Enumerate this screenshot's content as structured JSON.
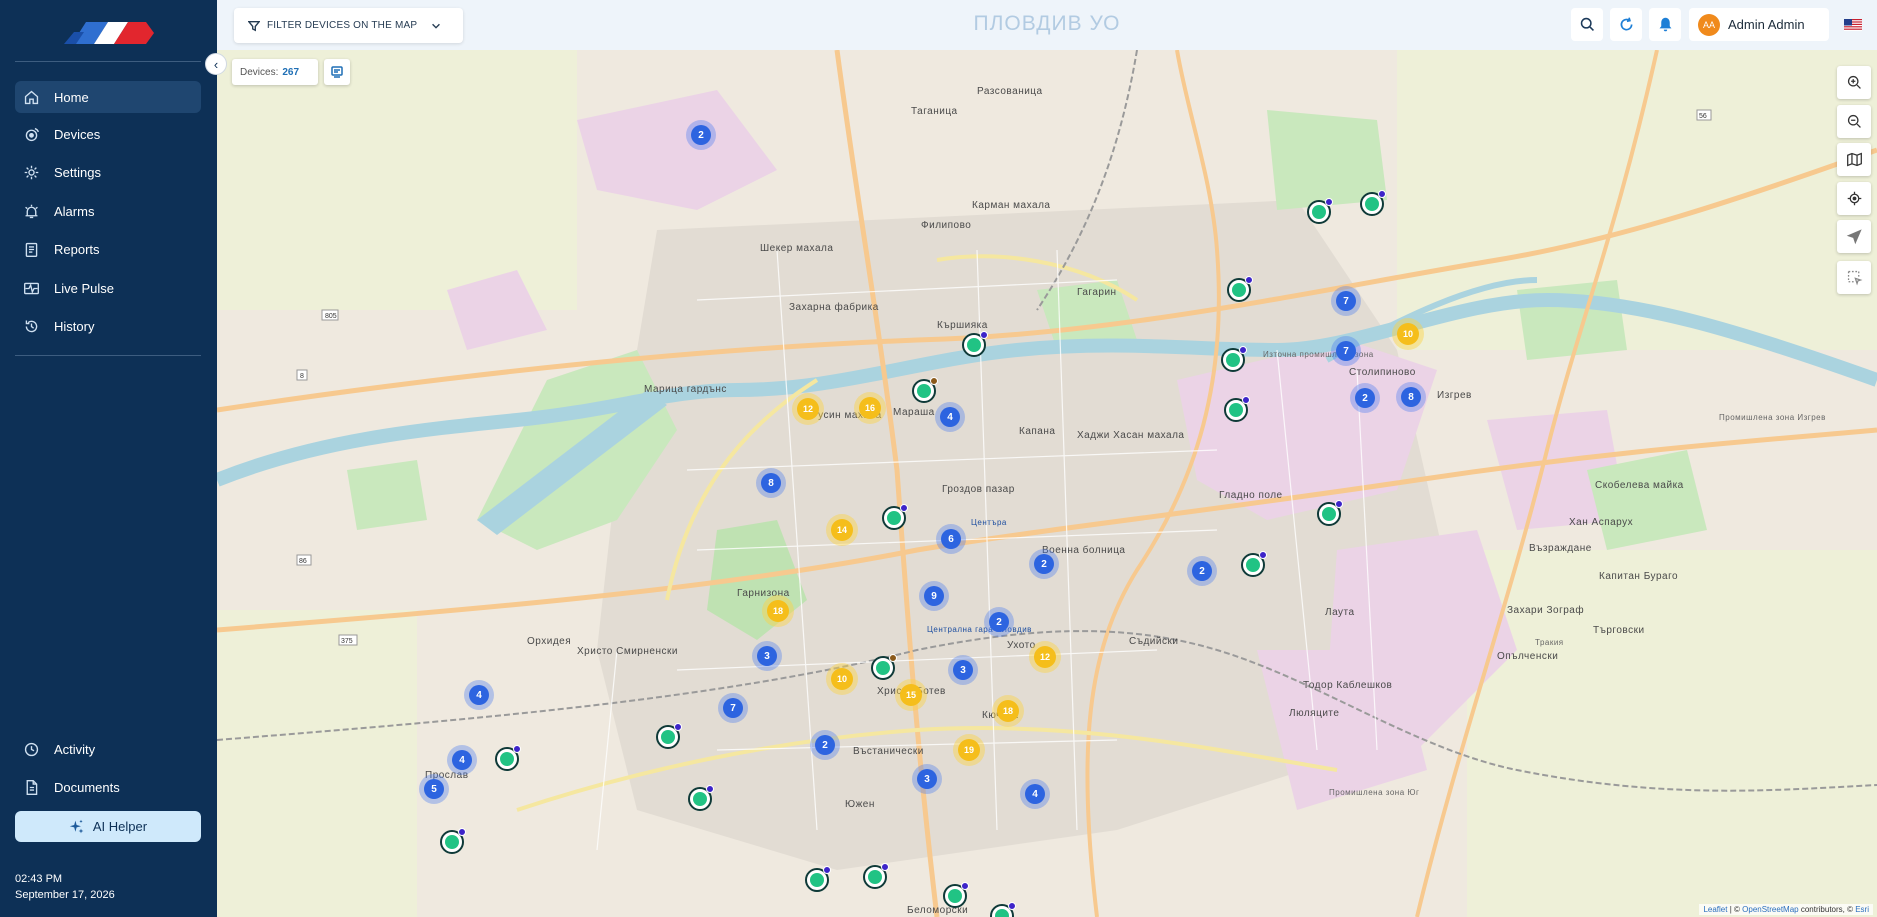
{
  "sidebar": {
    "items": [
      {
        "label": "Home",
        "icon": "home-icon"
      },
      {
        "label": "Devices",
        "icon": "devices-icon"
      },
      {
        "label": "Settings",
        "icon": "gear-icon"
      },
      {
        "label": "Alarms",
        "icon": "alarm-icon"
      },
      {
        "label": "Reports",
        "icon": "reports-icon"
      },
      {
        "label": "Live Pulse",
        "icon": "pulse-icon"
      },
      {
        "label": "History",
        "icon": "history-icon"
      }
    ],
    "bottom_items": [
      {
        "label": "Activity",
        "icon": "activity-icon"
      },
      {
        "label": "Documents",
        "icon": "documents-icon"
      }
    ],
    "ai_helper": "AI Helper",
    "time": "02:43 PM",
    "date": "September 17, 2026",
    "colors": {
      "bg": "#0d3056",
      "active": "#1f4670",
      "ai_helper_bg": "#cfe9fb"
    }
  },
  "topbar": {
    "filter_label": "FILTER DEVICES ON THE MAP",
    "title": "ПЛОВДИВ УО",
    "user_initials": "AA",
    "user_name": "Admin Admin",
    "icons": [
      "search-icon",
      "refresh-icon",
      "bell-icon"
    ],
    "language_flag": "us-flag-icon"
  },
  "map": {
    "devices_label": "Devices:",
    "devices_count": "267",
    "attribution_leaflet": "Leaflet",
    "attribution_rest": "| © ",
    "attribution_osm": "OpenStreetMap",
    "attribution_tail": " contributors, © ",
    "attribution_esri": "Esri",
    "controls": [
      "zoom-in-icon",
      "zoom-out-icon",
      "map-layers-icon",
      "locate-icon",
      "navigate-icon",
      "select-area-icon"
    ],
    "places": [
      {
        "name": "Разсованица"
      },
      {
        "name": "Таганица"
      },
      {
        "name": "Карман махала"
      },
      {
        "name": "Филипово"
      },
      {
        "name": "Шекер махала"
      },
      {
        "name": "Захарна фабрика"
      },
      {
        "name": "Гагарин"
      },
      {
        "name": "Кършияка"
      },
      {
        "name": "Марица гардънс"
      },
      {
        "name": "Русин махала"
      },
      {
        "name": "Мараша"
      },
      {
        "name": "Капана"
      },
      {
        "name": "Хаджи Хасан махала"
      },
      {
        "name": "Столипиново"
      },
      {
        "name": "Изгрев"
      },
      {
        "name": "Гроздов пазар"
      },
      {
        "name": "Гладно поле"
      },
      {
        "name": "Скобелева майка"
      },
      {
        "name": "Хан Аспарух"
      },
      {
        "name": "Възраждане"
      },
      {
        "name": "Военна болница"
      },
      {
        "name": "Капитан Бураго"
      },
      {
        "name": "Захари Зограф"
      },
      {
        "name": "Лаута"
      },
      {
        "name": "Търговски"
      },
      {
        "name": "Гарнизона"
      },
      {
        "name": "Орхидея"
      },
      {
        "name": "Христо Смирненски"
      },
      {
        "name": "Съдийски"
      },
      {
        "name": "Ухото"
      },
      {
        "name": "Опълченски"
      },
      {
        "name": "Тодор Каблешков"
      },
      {
        "name": "Люляците"
      },
      {
        "name": "Христо Ботев"
      },
      {
        "name": "Кючука"
      },
      {
        "name": "Въстанически"
      },
      {
        "name": "Прослав"
      },
      {
        "name": "Южен"
      },
      {
        "name": "Беломорски"
      },
      {
        "name": "Тракия"
      },
      {
        "name": "Централна гара Пловдив"
      },
      {
        "name": "Промишлена зона Изгрев"
      },
      {
        "name": "Промишлена зона Юг"
      },
      {
        "name": "Източна промишлена зона"
      },
      {
        "name": "Центъра"
      }
    ],
    "clusters": [
      {
        "count": "2",
        "type": "blue"
      },
      {
        "count": "7",
        "type": "blue"
      },
      {
        "count": "7",
        "type": "blue"
      },
      {
        "count": "10",
        "type": "yellow"
      },
      {
        "count": "2",
        "type": "blue"
      },
      {
        "count": "8",
        "type": "blue"
      },
      {
        "count": "12",
        "type": "yellow"
      },
      {
        "count": "16",
        "type": "yellow"
      },
      {
        "count": "4",
        "type": "blue"
      },
      {
        "count": "8",
        "type": "blue"
      },
      {
        "count": "14",
        "type": "yellow"
      },
      {
        "count": "6",
        "type": "blue"
      },
      {
        "count": "2",
        "type": "blue"
      },
      {
        "count": "2",
        "type": "blue"
      },
      {
        "count": "9",
        "type": "blue"
      },
      {
        "count": "18",
        "type": "yellow"
      },
      {
        "count": "2",
        "type": "blue"
      },
      {
        "count": "12",
        "type": "yellow"
      },
      {
        "count": "3",
        "type": "blue"
      },
      {
        "count": "3",
        "type": "blue"
      },
      {
        "count": "10",
        "type": "yellow"
      },
      {
        "count": "15",
        "type": "yellow"
      },
      {
        "count": "18",
        "type": "yellow"
      },
      {
        "count": "4",
        "type": "blue"
      },
      {
        "count": "7",
        "type": "blue"
      },
      {
        "count": "2",
        "type": "blue"
      },
      {
        "count": "19",
        "type": "yellow"
      },
      {
        "count": "4",
        "type": "blue"
      },
      {
        "count": "3",
        "type": "blue"
      },
      {
        "count": "5",
        "type": "blue"
      },
      {
        "count": "4",
        "type": "blue"
      }
    ],
    "road_labels": [
      {
        "text": "805"
      },
      {
        "text": "8"
      },
      {
        "text": "86"
      },
      {
        "text": "375"
      },
      {
        "text": "56"
      }
    ]
  }
}
